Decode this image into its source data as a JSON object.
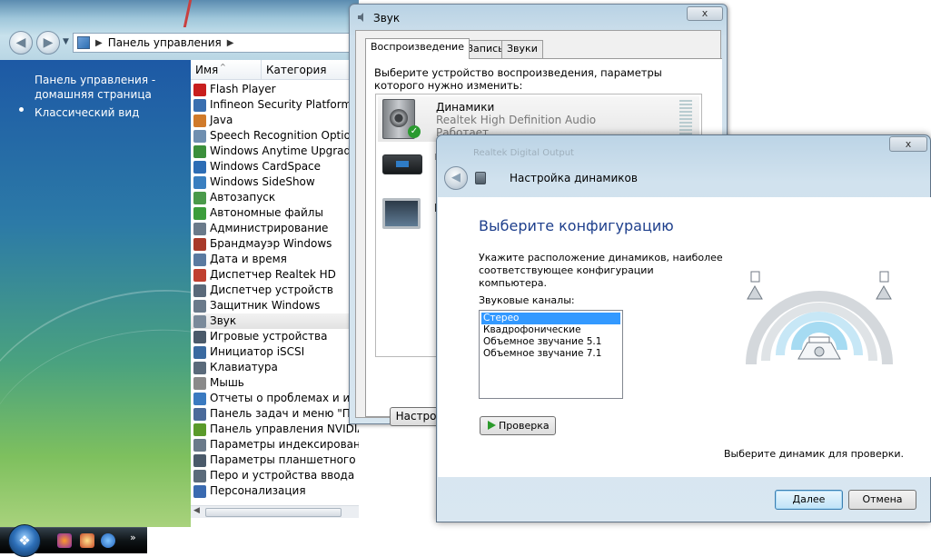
{
  "control_panel": {
    "address": "Панель управления",
    "sidebar": {
      "home_link": "Панель управления -",
      "home_link_2": "домашняя страница",
      "classic_view": "Классический вид"
    },
    "columns": {
      "name": "Имя",
      "category": "Категория"
    },
    "items": [
      {
        "label": "Flash Player",
        "color": "#c81e1e"
      },
      {
        "label": "Infineon Security Platform",
        "color": "#3a6fb0"
      },
      {
        "label": "Java",
        "color": "#d07a2a"
      },
      {
        "label": "Speech Recognition Options",
        "color": "#6f8fb0"
      },
      {
        "label": "Windows Anytime Upgrade",
        "color": "#3b8f3b"
      },
      {
        "label": "Windows CardSpace",
        "color": "#2d6db5"
      },
      {
        "label": "Windows SideShow",
        "color": "#3a7fc0"
      },
      {
        "label": "Автозапуск",
        "color": "#4a9a4a"
      },
      {
        "label": "Автономные файлы",
        "color": "#3b9d3b"
      },
      {
        "label": "Администрирование",
        "color": "#6a7a8a"
      },
      {
        "label": "Брандмауэр Windows",
        "color": "#a83a2a"
      },
      {
        "label": "Дата и время",
        "color": "#5a7aa0"
      },
      {
        "label": "Диспетчер Realtek HD",
        "color": "#c04030"
      },
      {
        "label": "Диспетчер устройств",
        "color": "#5a6a7a"
      },
      {
        "label": "Защитник Windows",
        "color": "#6a7a8a"
      },
      {
        "label": "Звук",
        "color": "#7a8a9a"
      },
      {
        "label": "Игровые устройства",
        "color": "#4a5a6a"
      },
      {
        "label": "Инициатор iSCSI",
        "color": "#3a6aa0"
      },
      {
        "label": "Клавиатура",
        "color": "#5a6a7a"
      },
      {
        "label": "Мышь",
        "color": "#8a8a8a"
      },
      {
        "label": "Отчеты о проблемах и их р",
        "color": "#3a7ac0"
      },
      {
        "label": "Панель задач и меню \"Пус",
        "color": "#4a6a9a"
      },
      {
        "label": "Панель управления NVIDIA",
        "color": "#5a9a2a"
      },
      {
        "label": "Параметры индексирования",
        "color": "#6a7a8a"
      },
      {
        "label": "Параметры планшетного компьютера",
        "color": "#4a5a6a"
      },
      {
        "label": "Перо и устройства ввода",
        "color": "#5a6a7a"
      },
      {
        "label": "Персонализация",
        "color": "#3a6ab0"
      }
    ],
    "selected_item": "Звук"
  },
  "sound_dialog": {
    "title": "Звук",
    "close": "x",
    "tabs": [
      "Воспроизведение",
      "Запись",
      "Звуки"
    ],
    "instructions": "Выберите устройство воспроизведения, параметры которого нужно изменить:",
    "device": {
      "name": "Динамики",
      "driver": "Realtek High Definition Audio",
      "status": "Работает"
    },
    "device_2_partial": "Realtek Digital Output",
    "device_3_partial": "L",
    "configure_button": "Настроить"
  },
  "setup_dialog": {
    "close": "x",
    "header_title": "Настройка динамиков",
    "heading": "Выберите конфигурацию",
    "instructions": "Укажите расположение динамиков, наиболее соответствующее конфигурации компьютера.",
    "channels_label": "Звуковые каналы:",
    "channels": [
      "Стерео",
      "Квадрофонические",
      "Объемное звучание 5.1",
      "Объемное звучание 7.1"
    ],
    "selected_channel": "Стерео",
    "test_button": "Проверка",
    "speaker_hint": "Выберите динамик для проверки.",
    "next_button": "Далее",
    "cancel_button": "Отмена"
  },
  "taskbar": {
    "chevron": "»",
    "icons": [
      "media-player-icon",
      "paint-icon",
      "internet-explorer-icon"
    ]
  }
}
